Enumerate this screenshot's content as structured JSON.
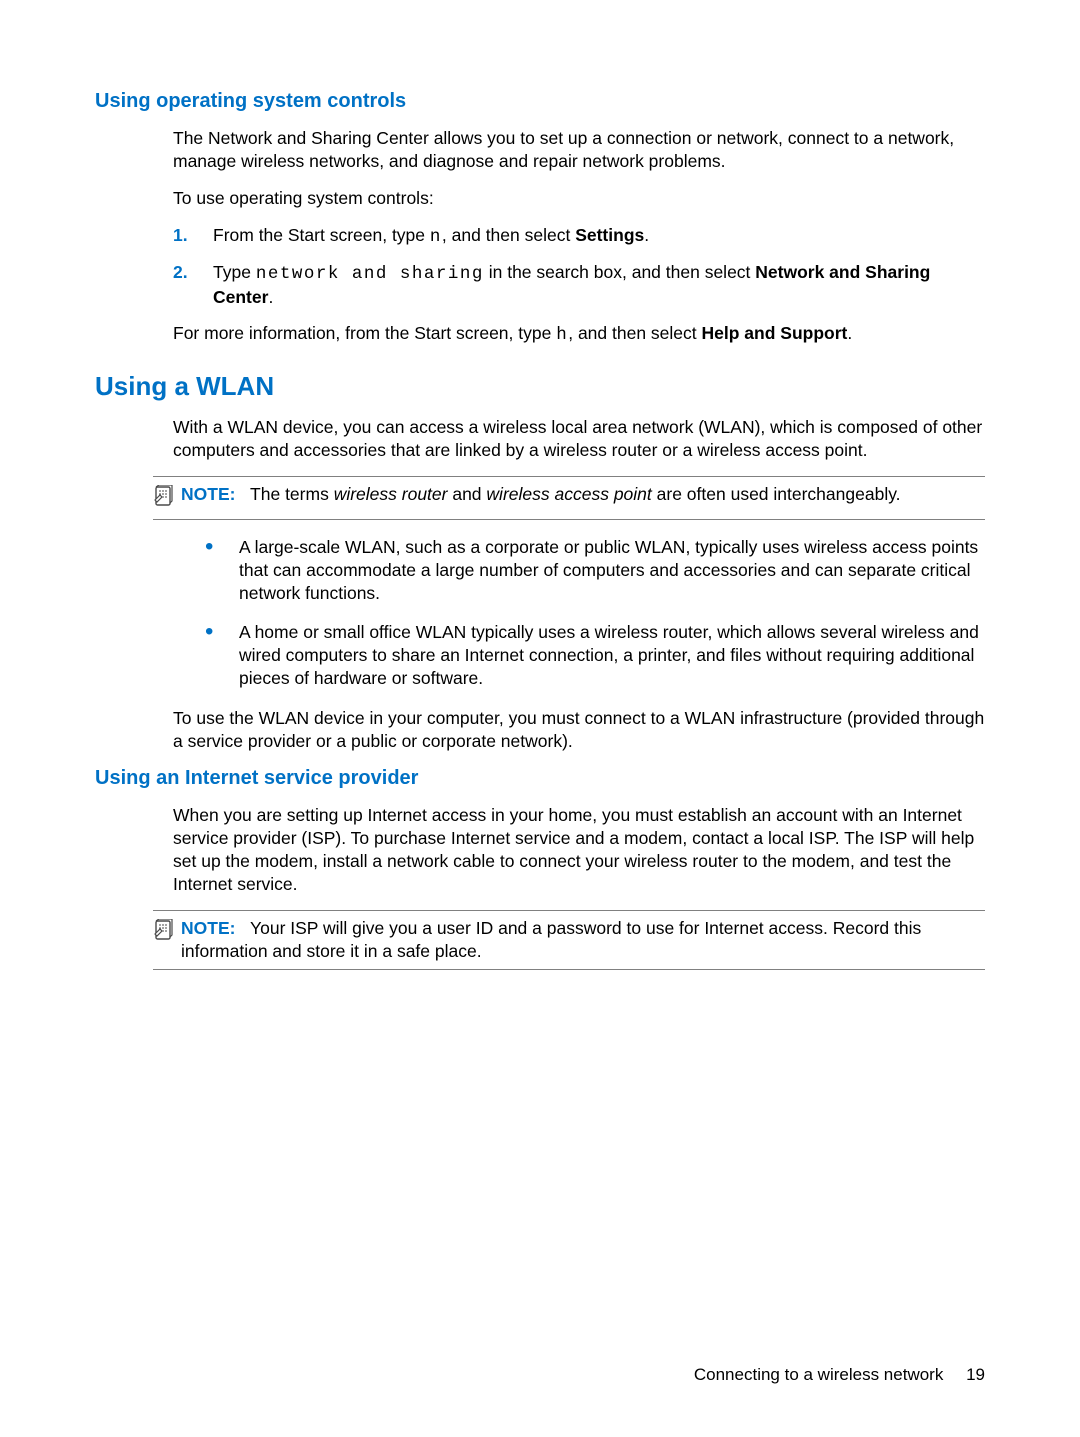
{
  "section1": {
    "heading": "Using operating system controls",
    "p1": "The Network and Sharing Center allows you to set up a connection or network, connect to a network, manage wireless networks, and diagnose and repair network problems.",
    "p2": "To use operating system controls:",
    "step1_prefix": "From the Start screen, type ",
    "step1_code": "n",
    "step1_mid": ", and then select ",
    "step1_bold": "Settings",
    "step1_suffix": ".",
    "step2_prefix": "Type ",
    "step2_code": "network and sharing",
    "step2_mid": " in the search box, and then select ",
    "step2_bold": "Network and Sharing Center",
    "step2_suffix": ".",
    "p3_prefix": "For more information, from the Start screen, type ",
    "p3_code": "h",
    "p3_mid": ", and then select ",
    "p3_bold": "Help and Support",
    "p3_suffix": "."
  },
  "section2": {
    "heading": "Using a WLAN",
    "p1": "With a WLAN device, you can access a wireless local area network (WLAN), which is composed of other computers and accessories that are linked by a wireless router or a wireless access point.",
    "note_label": "NOTE:",
    "note_prefix": "The terms ",
    "note_i1": "wireless router",
    "note_mid": " and ",
    "note_i2": "wireless access point",
    "note_suffix": " are often used interchangeably.",
    "bullet1": "A large-scale WLAN, such as a corporate or public WLAN, typically uses wireless access points that can accommodate a large number of computers and accessories and can separate critical network functions.",
    "bullet2": "A home or small office WLAN typically uses a wireless router, which allows several wireless and wired computers to share an Internet connection, a printer, and files without requiring additional pieces of hardware or software.",
    "p2": "To use the WLAN device in your computer, you must connect to a WLAN infrastructure (provided through a service provider or a public or corporate network)."
  },
  "section3": {
    "heading": "Using an Internet service provider",
    "p1": "When you are setting up Internet access in your home, you must establish an account with an Internet service provider (ISP). To purchase Internet service and a modem, contact a local ISP. The ISP will help set up the modem, install a network cable to connect your wireless router to the modem, and test the Internet service.",
    "note_label": "NOTE:",
    "note_text": "Your ISP will give you a user ID and a password to use for Internet access. Record this information and store it in a safe place."
  },
  "footer": {
    "text": "Connecting to a wireless network",
    "page": "19"
  },
  "nums": {
    "one": "1.",
    "two": "2."
  }
}
